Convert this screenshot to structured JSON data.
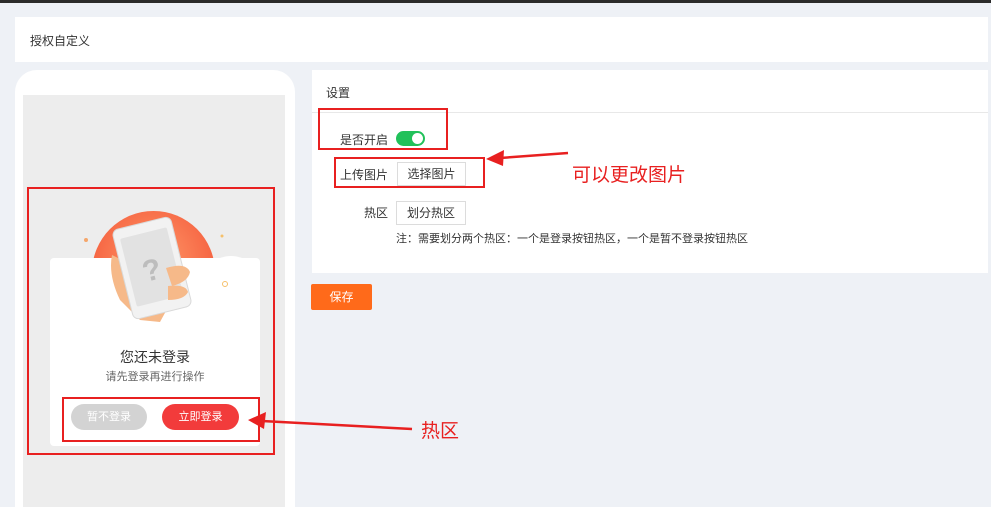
{
  "page": {
    "title": "授权自定义"
  },
  "preview": {
    "title": "您还未登录",
    "subtitle": "请先登录再进行操作",
    "btn_later": "暂不登录",
    "btn_login": "立即登录",
    "illustration_icon": "phone-question-icon"
  },
  "settings": {
    "header": "设置",
    "enable_label": "是否开启",
    "enable_value": true,
    "upload_label": "上传图片",
    "upload_button": "选择图片",
    "hotzone_label": "热区",
    "hotzone_button": "划分热区",
    "note": "注：需要划分两个热区：一个是登录按钮热区，一个是暂不登录按钮热区",
    "save_button": "保存"
  },
  "annotations": {
    "change_image": "可以更改图片",
    "hotzone": "热区"
  },
  "colors": {
    "accent_orange": "#ff6a1a",
    "toggle_green": "#21c15a",
    "annotation_red": "#e82020",
    "login_red": "#f23b3b"
  }
}
